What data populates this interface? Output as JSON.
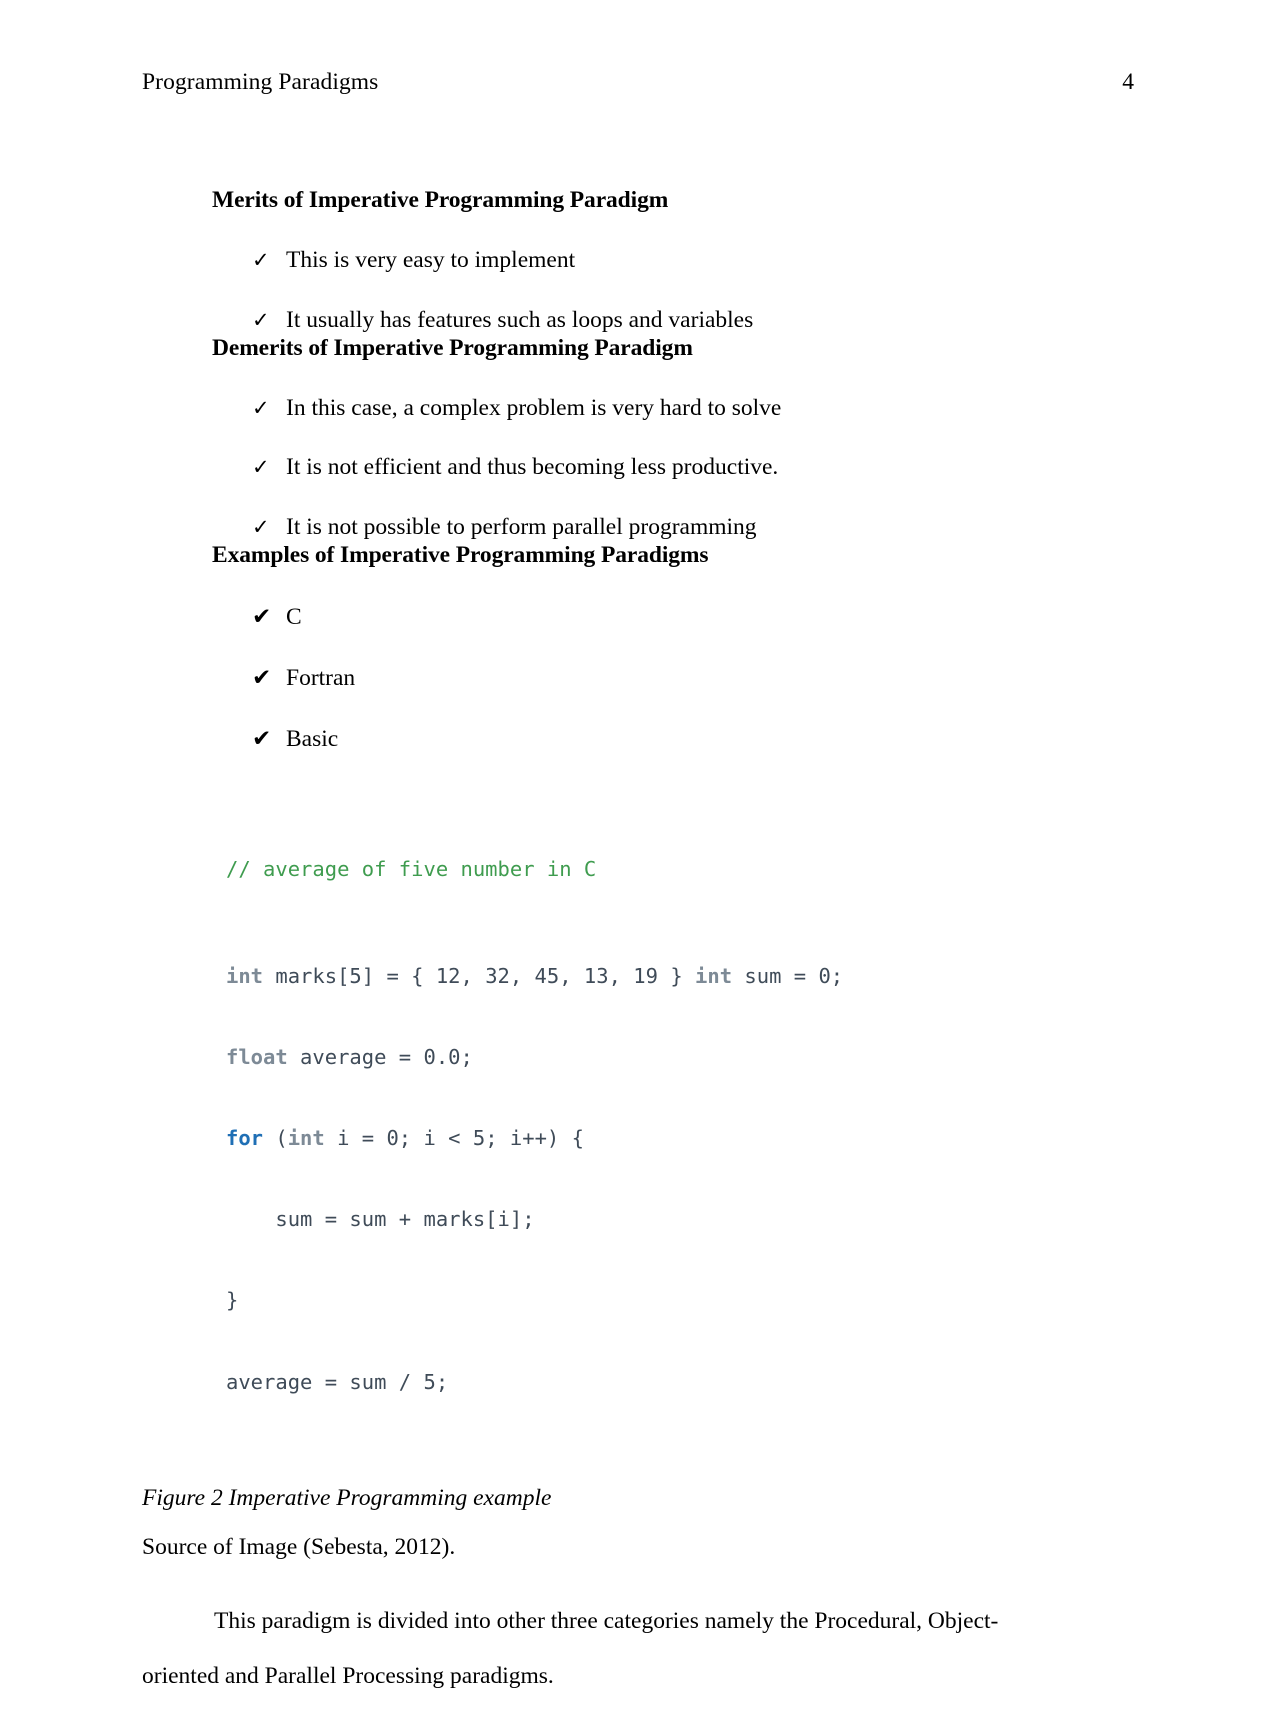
{
  "header": {
    "running_title": "Programming Paradigms",
    "page_number": "4"
  },
  "sections": [
    {
      "heading": "Merits of Imperative Programming Paradigm",
      "bullet_glyph": "✓",
      "items": [
        "This is very easy to implement",
        "It usually has features such as loops and variables"
      ]
    },
    {
      "heading": "Demerits of Imperative Programming Paradigm",
      "bullet_glyph": "✓",
      "items": [
        "In this case, a complex problem is very hard to solve",
        "It is not efficient and thus becoming less productive.",
        "It is not possible to perform parallel programming"
      ]
    },
    {
      "heading": "Examples of Imperative Programming Paradigms",
      "bullet_glyph": "✔",
      "items": [
        "C",
        "Fortran",
        "Basic"
      ]
    }
  ],
  "code_figure": {
    "language": "C",
    "comment_line": "// average of five number in C",
    "lines": [
      {
        "tokens": [
          {
            "text": "int",
            "style": "kw-type"
          },
          {
            "text": " marks[5] = { 12, 32, 45, 13, 19 } ",
            "style": "code-plain"
          },
          {
            "text": "int",
            "style": "kw-type"
          },
          {
            "text": " sum = 0;",
            "style": "code-plain"
          }
        ]
      },
      {
        "tokens": [
          {
            "text": "float",
            "style": "kw-type"
          },
          {
            "text": " average = 0.0;",
            "style": "code-plain"
          }
        ]
      },
      {
        "tokens": [
          {
            "text": "for",
            "style": "kw-ctrl"
          },
          {
            "text": " (",
            "style": "code-plain"
          },
          {
            "text": "int",
            "style": "kw-type"
          },
          {
            "text": " i = 0; i < 5; i++) {",
            "style": "code-plain"
          }
        ]
      },
      {
        "tokens": [
          {
            "text": "    sum = sum + marks[i];",
            "style": "code-plain"
          }
        ]
      },
      {
        "tokens": [
          {
            "text": "}",
            "style": "code-plain"
          }
        ]
      },
      {
        "tokens": [
          {
            "text": "average = sum / 5;",
            "style": "code-plain"
          }
        ]
      }
    ],
    "colors": {
      "comment": "#3f9c4f",
      "type_keyword": "#7d8a96",
      "control_keyword": "#1f6fb5",
      "plain": "#3f4b58"
    }
  },
  "figure_caption": "Figure 2 Imperative Programming example",
  "source_line": "Source of Image (Sebesta, 2012).",
  "body_paragraph": "This paradigm is divided into other three categories namely the Procedural, Object-oriented and Parallel Processing paradigms."
}
